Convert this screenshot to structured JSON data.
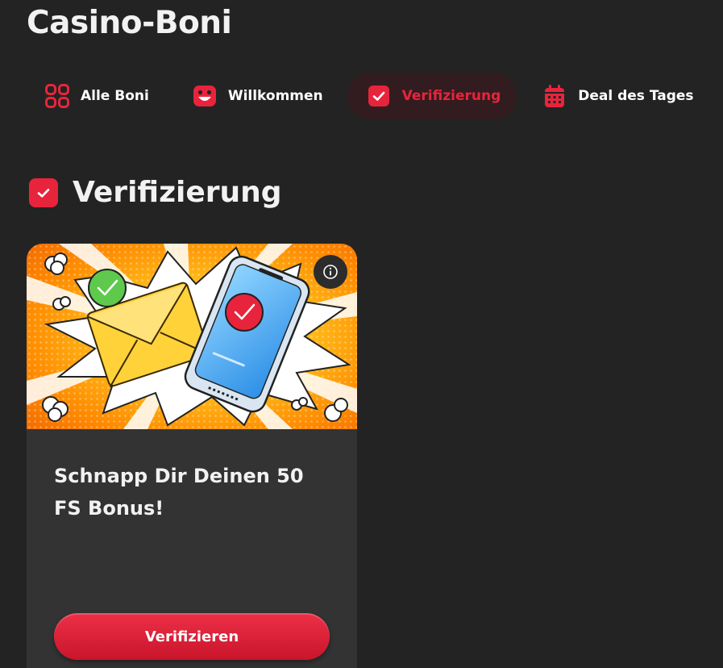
{
  "page": {
    "title": "Casino-Boni"
  },
  "tabs": [
    {
      "label": "Alle Boni",
      "icon": "grid-icon",
      "active": false
    },
    {
      "label": "Willkommen",
      "icon": "smiley-icon",
      "active": false
    },
    {
      "label": "Verifizierung",
      "icon": "checkbox-icon",
      "active": true
    },
    {
      "label": "Deal des Tages",
      "icon": "calendar-icon",
      "active": false
    }
  ],
  "section": {
    "heading": "Verifizierung",
    "icon": "checkbox-icon"
  },
  "card": {
    "title": "Schnapp Dir Deinen 50 FS Bonus!",
    "button_label": "Verifizieren",
    "image_subject": "envelope-and-phone-with-checkmarks",
    "info_icon": "info-icon"
  },
  "colors": {
    "background": "#232323",
    "accent": "#e8243c",
    "active_tab_bg": "#331c1f",
    "card_bg": "#333333",
    "text": "#f2f2f2"
  }
}
